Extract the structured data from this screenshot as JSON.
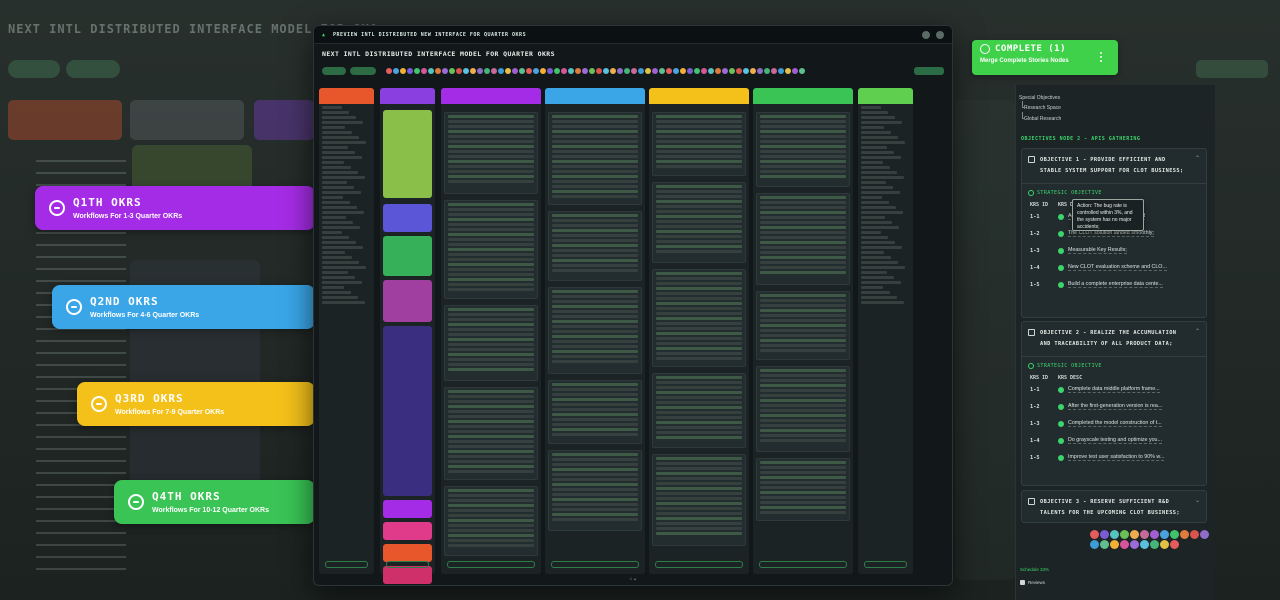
{
  "background": {
    "title": "NEXT INTL DISTRIBUTED INTERFACE MODEL FOR QUA"
  },
  "quarters": [
    {
      "title": "Q1TH OKRS",
      "subtitle": "Workflows For 1-3 Quarter OKRs",
      "color": "#a52ce6"
    },
    {
      "title": "Q2ND OKRS",
      "subtitle": "Workflows For 4-6 Quarter OKRs",
      "color": "#3aa6e8"
    },
    {
      "title": "Q3RD OKRS",
      "subtitle": "Workflows For 7-9 Quarter OKRs",
      "color": "#f3c11a"
    },
    {
      "title": "Q4TH OKRS",
      "subtitle": "Workflows For 10-12 Quarter OKRs",
      "color": "#39c455"
    }
  ],
  "app": {
    "window_title": "PREVIEW INTL DISTRIBUTED NEW INTERFACE FOR QUARTER OKRS",
    "page_title": "NEXT INTL DISTRIBUTED INTERFACE MODEL FOR QUARTER OKRS",
    "columns": [
      {
        "color": "#e8562c"
      },
      {
        "color": "#8a3fe0"
      },
      {
        "color": "#a52ce6"
      },
      {
        "color": "#3aa6e8"
      },
      {
        "color": "#f3c11a"
      },
      {
        "color": "#39c455"
      },
      {
        "color": "#5fcf4f"
      }
    ]
  },
  "complete": {
    "title": "COMPLETE (1)",
    "subtitle": "Merge Complete Stories Nodes",
    "color": "#3fd14a"
  },
  "panel": {
    "tree": [
      "Special Objectives",
      "Research Space",
      "Global Research"
    ],
    "section_title": "OBJECTIVES NODE 2 - APIS GATHERING",
    "strategic_label": "STRATEGIC OBJECTIVE",
    "col_krs": "KRS ID",
    "col_desc": "KRS DESC",
    "tooltip": "Action: The bug rate is controlled within 3%, and the system has no major accidents;",
    "objectives": [
      {
        "title": "OBJECTIVE 1 - PROVIDE EFFICIENT AND STABLE SYSTEM SUPPORT FOR CLOT BUSINESS;",
        "krs": [
          {
            "id": "1-1",
            "desc": "Action: The bug rate is controlled"
          },
          {
            "id": "1-2",
            "desc": "The CLOT solution landed smoothly;"
          },
          {
            "id": "1-3",
            "desc": "Measurable Key Results;"
          },
          {
            "id": "1-4",
            "desc": "New CLOT evaluation scheme and CLO..."
          },
          {
            "id": "1-5",
            "desc": "Build a complete enterprise data cente..."
          }
        ]
      },
      {
        "title": "OBJECTIVE 2 - REALIZE THE ACCUMULATION AND TRACEABILITY OF ALL PRODUCT DATA;",
        "krs": [
          {
            "id": "1-1",
            "desc": "Complete data middle platform frame..."
          },
          {
            "id": "1-2",
            "desc": "After the first-generation version is rea..."
          },
          {
            "id": "1-3",
            "desc": "Completed the model construction of t..."
          },
          {
            "id": "1-4",
            "desc": "Do grayscale testing and optimize you..."
          },
          {
            "id": "1-5",
            "desc": "Improve test user satisfaction to 90% w..."
          }
        ]
      },
      {
        "title": "OBJECTIVE 3 - RESERVE SUFFICIENT R&D TALENTS FOR THE UPCOMING CLOT BUSINESS;",
        "krs": []
      }
    ],
    "footer_progress": "Schedule 33%",
    "footer_label": "Reviews"
  },
  "avatar_colors": [
    "#e45c5c",
    "#4aa3df",
    "#f2b134",
    "#7c5cd6",
    "#3fc46b",
    "#d8559c",
    "#55c3c0",
    "#e07b39",
    "#9c6ad9",
    "#6bbf59",
    "#d9534f",
    "#5bc0de",
    "#f0ad4e",
    "#8e6cc7",
    "#45b37a",
    "#c76a9a",
    "#3d9bd6",
    "#e2c044",
    "#a05fd0",
    "#5fbf8f"
  ]
}
